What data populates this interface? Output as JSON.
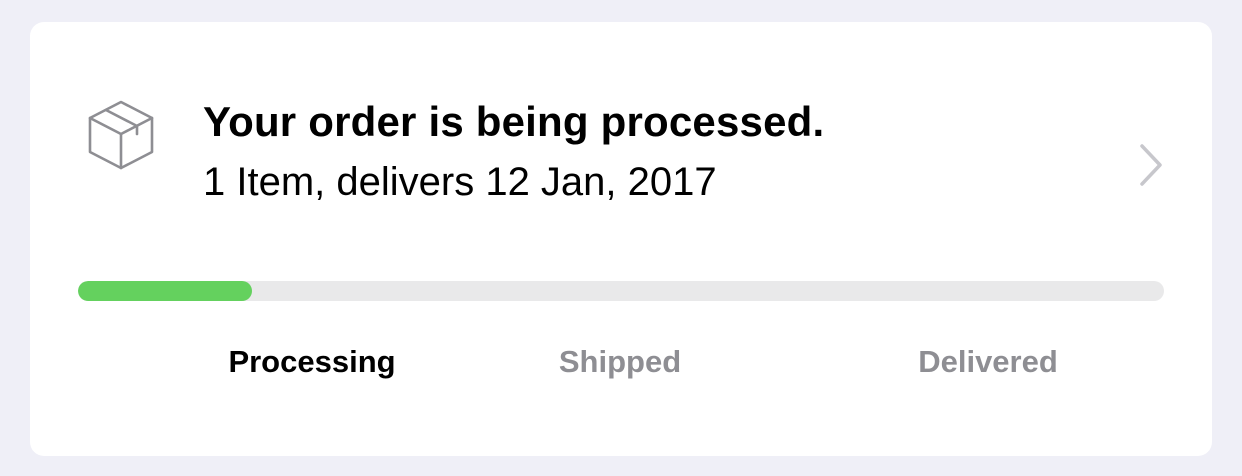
{
  "order": {
    "title": "Your order is being processed.",
    "subtitle": "1 Item, delivers 12 Jan, 2017",
    "progress_fraction": 0.16,
    "stages": [
      {
        "label": "Processing",
        "active": true
      },
      {
        "label": "Shipped",
        "active": false
      },
      {
        "label": "Delivered",
        "active": false
      }
    ]
  },
  "icons": {
    "package": "package-box-icon",
    "chevron": "chevron-right-icon"
  },
  "colors": {
    "background": "#efeff7",
    "card": "#ffffff",
    "progress_fill": "#64d15e",
    "progress_track": "#e9e9ea",
    "inactive_text": "#8e8e93",
    "icon_gray": "#8e8e93",
    "chevron_gray": "#c7c7cc"
  }
}
